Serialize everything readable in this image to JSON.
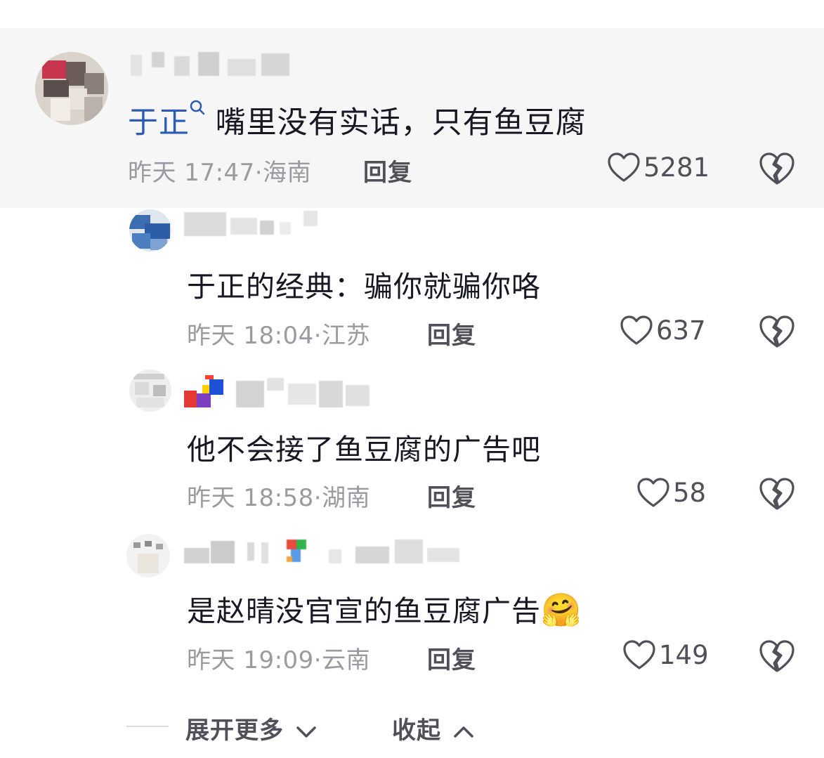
{
  "comments": [
    {
      "mention": "于正",
      "text": "嘴里没有实话，只有鱼豆腐",
      "time": "昨天 17:47",
      "location": "海南",
      "reply_label": "回复",
      "likes": "5281"
    },
    {
      "text": "于正的经典：骗你就骗你咯",
      "time": "昨天 18:04",
      "location": "江苏",
      "reply_label": "回复",
      "likes": "637"
    },
    {
      "text": "他不会接了鱼豆腐的广告吧",
      "time": "昨天 18:58",
      "location": "湖南",
      "reply_label": "回复",
      "likes": "58"
    },
    {
      "text": "是赵晴没官宣的鱼豆腐广告",
      "emoji": "🤗",
      "time": "昨天 19:09",
      "location": "云南",
      "reply_label": "回复",
      "likes": "149"
    }
  ],
  "footer": {
    "expand_label": "展开更多",
    "collapse_label": "收起"
  },
  "icons": {
    "heart": "heart-icon",
    "broken_heart": "broken-heart-icon",
    "search": "search-icon"
  },
  "colors": {
    "mention": "#2b5bb5",
    "meta": "#9a9ba0",
    "action": "#4f5058",
    "highlight_bg": "#f6f6f6"
  }
}
